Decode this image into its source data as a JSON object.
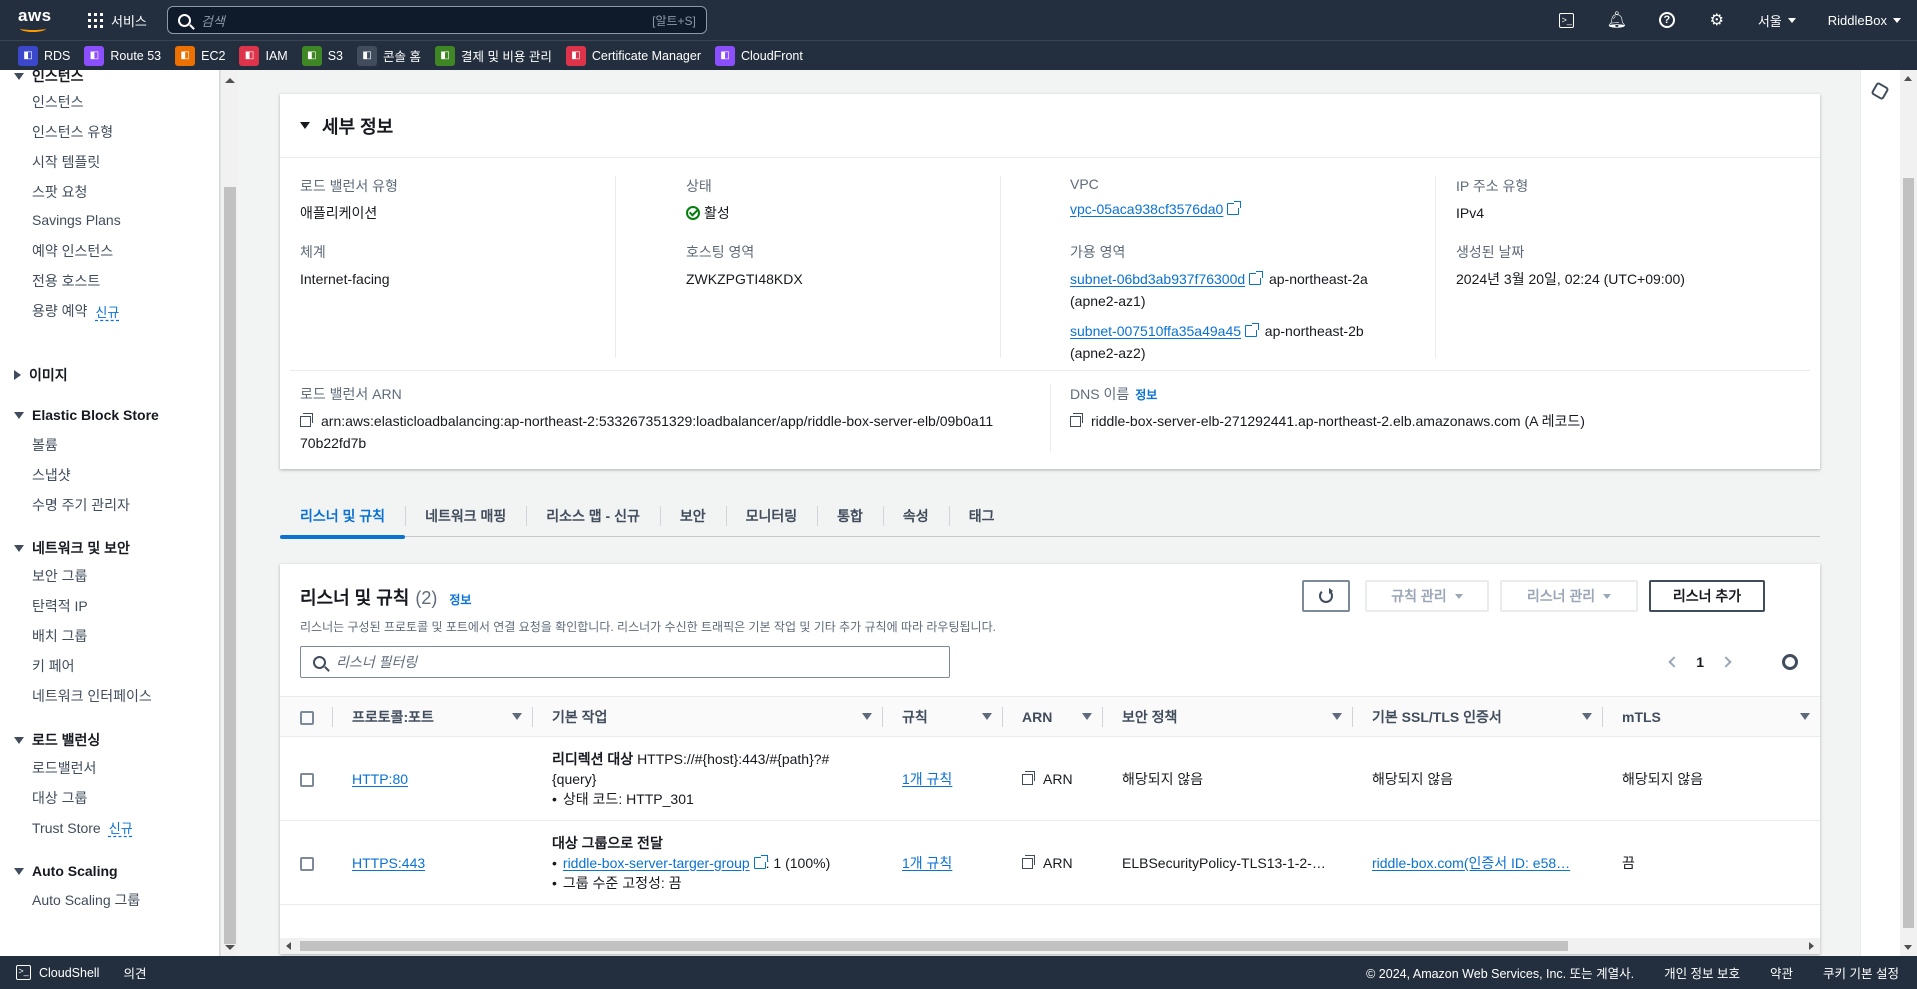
{
  "topnav": {
    "logo": "aws",
    "services_label": "서비스",
    "search_placeholder": "검색",
    "search_shortcut": "[알트+S]",
    "region": "서울",
    "account": "RiddleBox"
  },
  "favorites": [
    {
      "label": "RDS",
      "color": "#3b48cc",
      "icon": "rds-icon"
    },
    {
      "label": "Route 53",
      "color": "#8c4fff",
      "icon": "route53-icon"
    },
    {
      "label": "EC2",
      "color": "#ed7100",
      "icon": "ec2-icon"
    },
    {
      "label": "IAM",
      "color": "#dd344c",
      "icon": "iam-icon"
    },
    {
      "label": "S3",
      "color": "#3f8624",
      "icon": "s3-icon"
    },
    {
      "label": "콘솔 홈",
      "color": "#414d5c",
      "icon": "console-home-icon"
    },
    {
      "label": "결제 및 비용 관리",
      "color": "#3f8624",
      "icon": "billing-icon"
    },
    {
      "label": "Certificate Manager",
      "color": "#dd344c",
      "icon": "certificate-manager-icon"
    },
    {
      "label": "CloudFront",
      "color": "#8c4fff",
      "icon": "cloudfront-icon"
    }
  ],
  "sidebar": {
    "sec_instances": "인스턴스",
    "instances": "인스턴스",
    "instance_types": "인스턴스 유형",
    "launch_templates": "시작 템플릿",
    "spot_requests": "스팟 요청",
    "savings_plans": "Savings Plans",
    "reserved_instances": "예약 인스턴스",
    "dedicated_hosts": "전용 호스트",
    "capacity_reservations": "용량 예약",
    "new_badge": "신규",
    "sec_images": "이미지",
    "sec_ebs": "Elastic Block Store",
    "volumes": "볼륨",
    "snapshots": "스냅샷",
    "lifecycle_manager": "수명 주기 관리자",
    "sec_network": "네트워크 및 보안",
    "security_groups": "보안 그룹",
    "elastic_ips": "탄력적 IP",
    "placement_groups": "배치 그룹",
    "key_pairs": "키 페어",
    "network_interfaces": "네트워크 인터페이스",
    "sec_lb": "로드 밸런싱",
    "load_balancers": "로드밸런서",
    "target_groups": "대상 그룹",
    "trust_store": "Trust Store",
    "sec_autoscaling": "Auto Scaling",
    "autoscaling_groups": "Auto Scaling 그룹"
  },
  "details": {
    "title": "세부 정보",
    "lb_type_label": "로드 밸런서 유형",
    "lb_type_value": "애플리케이션",
    "scheme_label": "체계",
    "scheme_value": "Internet-facing",
    "status_label": "상태",
    "status_value": "활성",
    "hosted_zone_label": "호스팅 영역",
    "hosted_zone_value": "ZWKZPGTI48KDX",
    "vpc_label": "VPC",
    "vpc_value": "vpc-05aca938cf3576da0",
    "az_label": "가용 영역",
    "subnet1": "subnet-06bd3ab937f76300d",
    "subnet1_az": "ap-northeast-2a",
    "subnet1_azid": "(apne2-az1)",
    "subnet2": "subnet-007510ffa35a49a45",
    "subnet2_az": "ap-northeast-2b",
    "subnet2_azid": "(apne2-az2)",
    "ip_type_label": "IP 주소 유형",
    "ip_type_value": "IPv4",
    "created_label": "생성된 날짜",
    "created_value": "2024년 3월 20일, 02:24 (UTC+09:00)",
    "arn_label": "로드 밸런서 ARN",
    "arn_line1": "arn:aws:elasticloadbalancing:ap-northeast-2:533267351329:loadbalancer/app/riddle-box-server-elb/09b0a11",
    "arn_line2": "70b22fd7b",
    "dns_label": "DNS 이름",
    "dns_info": "정보",
    "dns_value": "riddle-box-server-elb-271292441.ap-northeast-2.elb.amazonaws.com (A 레코드)"
  },
  "tabs": [
    {
      "label": "리스너 및 규칙",
      "active": true
    },
    {
      "label": "네트워크 매핑",
      "active": false
    },
    {
      "label": "리소스 맵 - 신규",
      "active": false
    },
    {
      "label": "보안",
      "active": false
    },
    {
      "label": "모니터링",
      "active": false
    },
    {
      "label": "통합",
      "active": false
    },
    {
      "label": "속성",
      "active": false
    },
    {
      "label": "태그",
      "active": false
    }
  ],
  "listeners": {
    "title": "리스너 및 규칙",
    "count": "(2)",
    "info": "정보",
    "description": "리스너는 구성된 프로토콜 및 포트에서 연결 요청을 확인합니다. 리스너가 수신한 트래픽은 기본 작업 및 기타 추가 규칙에 따라 라우팅됩니다.",
    "manage_rules": "규칙 관리",
    "manage_listener": "리스너 관리",
    "add_listener": "리스너 추가",
    "filter_placeholder": "리스너 필터링",
    "page": "1",
    "columns": [
      "프로토콜:포트",
      "기본 작업",
      "규칙",
      "ARN",
      "보안 정책",
      "기본 SSL/TLS 인증서",
      "mTLS"
    ],
    "row1": {
      "protocol": "HTTP:80",
      "action_title": "리디렉션 대상",
      "action_target_1": "HTTPS://#{host}:443/#{path}?#",
      "action_target_2": "{query}",
      "action_bullet": "상태 코드: HTTP_301",
      "rules": "1개 규칙",
      "arn": "ARN",
      "policy": "해당되지 않음",
      "cert": "해당되지 않음",
      "mtls": "해당되지 않음"
    },
    "row2": {
      "protocol": "HTTPS:443",
      "action_title": "대상 그룹으로 전달",
      "target_group": "riddle-box-server-targer-group",
      "weight": ": 1 (100%)",
      "stickiness": "그룹 수준 고정성: 끔",
      "rules": "1개 규칙",
      "arn": "ARN",
      "policy": "ELBSecurityPolicy-TLS13-1-2-…",
      "cert": "riddle-box.com(인증서 ID: e58…",
      "mtls": "끔"
    }
  },
  "footer": {
    "cloudshell": "CloudShell",
    "feedback": "의견",
    "copyright": "© 2024, Amazon Web Services, Inc. 또는 계열사.",
    "privacy": "개인 정보 보호",
    "terms": "약관",
    "cookies": "쿠키 기본 설정"
  }
}
